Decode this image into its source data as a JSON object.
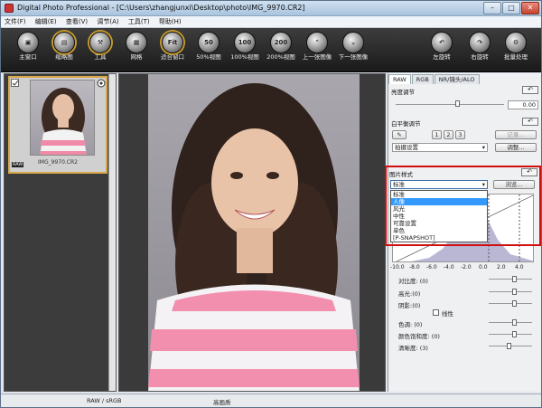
{
  "titlebar": {
    "title": "Digital Photo Professional - [C:\\Users\\zhangjunxi\\Desktop\\photo\\IMG_9970.CR2]",
    "min": "–",
    "max": "□",
    "close": "✕"
  },
  "menu": [
    "文件(F)",
    "编辑(E)",
    "查看(V)",
    "调节(A)",
    "工具(T)",
    "帮助(H)"
  ],
  "toolbar": [
    {
      "label": "主窗口",
      "icon": "main-window-icon",
      "glyph": "▣"
    },
    {
      "label": "缩略图",
      "icon": "thumbnail-icon",
      "glyph": "▤"
    },
    {
      "label": "工具",
      "icon": "tools-icon",
      "glyph": "⚒"
    },
    {
      "label": "网格",
      "icon": "grid-icon",
      "glyph": "▦"
    },
    {
      "label": "适合窗口",
      "icon": "fit-window-icon",
      "glyph": "Fit"
    },
    {
      "label": "50%视图",
      "icon": "zoom-50-icon",
      "glyph": "50"
    },
    {
      "label": "100%视图",
      "icon": "zoom-100-icon",
      "glyph": "100"
    },
    {
      "label": "200%视图",
      "icon": "zoom-200-icon",
      "glyph": "200"
    },
    {
      "label": "上一张图像",
      "icon": "previous-image-icon",
      "glyph": "⌃"
    },
    {
      "label": "下一张图像",
      "icon": "next-image-icon",
      "glyph": "⌄"
    },
    {
      "label": "左旋转",
      "icon": "rotate-left-icon",
      "glyph": "↶"
    },
    {
      "label": "右旋转",
      "icon": "rotate-right-icon",
      "glyph": "↷"
    },
    {
      "label": "批量处理",
      "icon": "batch-process-icon",
      "glyph": "⚙"
    }
  ],
  "thumbnail": {
    "filename": "IMG_9970.CR2",
    "raw_badge": "RAW"
  },
  "rightpane": {
    "tabs": [
      "RAW",
      "RGB",
      "NR/镜头/ALO"
    ],
    "brightness": {
      "title": "亮度调节",
      "value": "0.00"
    },
    "white_balance": {
      "title": "白平衡调节",
      "presets": [
        "1",
        "2",
        "3"
      ],
      "record_button": "记录...",
      "mode": "拍摄设置",
      "adjust_button": "调整..."
    },
    "picture_style": {
      "title": "图片样式",
      "selected": "标准",
      "browse_button": "浏览...",
      "options": [
        "标准",
        "人像",
        "风光",
        "中性",
        "可靠设置",
        "单色",
        "[P-SNAPSHOT]"
      ],
      "highlighted_index": 1
    },
    "axis_ticks": [
      "-10.0",
      "-8.0",
      "-6.0",
      "-4.0",
      "-2.0",
      "0.0",
      "2.0",
      "4.0"
    ],
    "params": [
      {
        "label": "对比度: (0)"
      },
      {
        "label": "高光:(0)"
      },
      {
        "label": "阴影:(0)"
      },
      {
        "label": "线性"
      },
      {
        "label": "色调: (0)"
      },
      {
        "label": "颜色饱和度: (0)"
      },
      {
        "label": "清晰度: (3)"
      }
    ]
  },
  "status": {
    "colorspace": "RAW / sRGB",
    "quality": "高画质"
  }
}
